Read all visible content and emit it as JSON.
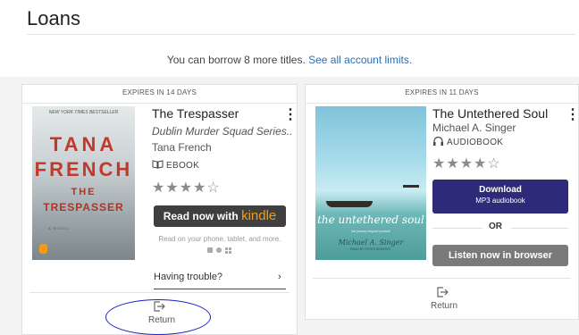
{
  "page": {
    "title": "Loans"
  },
  "limits": {
    "text": "You can borrow 8 more titles. ",
    "link": "See all account limits."
  },
  "loans": [
    {
      "expires": "EXPIRES IN 14 DAYS",
      "title": "The Trespasser",
      "series": "Dublin Murder Squad Series...",
      "author": "Tana French",
      "format": "EBOOK",
      "format_icon": "book-icon",
      "rating_stars": 4,
      "rating_display": "★★★★☆",
      "cover": {
        "banner": "NEW YORK TIMES BESTSELLER",
        "line1": "TANA",
        "line2": "FRENCH",
        "line3": "THE",
        "line4": "TRESPASSER",
        "tag": "A NOVEL"
      },
      "read_button": {
        "prefix": "Read now with ",
        "brand": "kindle"
      },
      "read_note": "Read on your phone, tablet, and more.",
      "device_icons": [
        "android-icon",
        "apple-icon",
        "windows-icon"
      ],
      "trouble": {
        "label": "Having trouble?",
        "arrow": "›"
      },
      "return_label": "Return"
    },
    {
      "expires": "EXPIRES IN 11 DAYS",
      "title": "The Untethered Soul",
      "author": "Michael A. Singer",
      "format": "AUDIOBOOK",
      "format_icon": "headphones-icon",
      "rating_stars": 4,
      "rating_display": "★★★★☆",
      "cover": {
        "title": "the untethered soul",
        "subtitle": "the journey beyond yourself",
        "author": "Michael A. Singer",
        "narrator": "READ BY PETER BERKROT"
      },
      "download_button": {
        "line1": "Download",
        "line2": "MP3 audiobook"
      },
      "or_label": "OR",
      "listen_button": "Listen now in browser",
      "return_label": "Return"
    }
  ],
  "kebab": "⋮",
  "colors": {
    "accent": "#2d2a7a",
    "kindle": "#f39c12",
    "link": "#2a6ebb",
    "annotation": "#1a20c8"
  }
}
